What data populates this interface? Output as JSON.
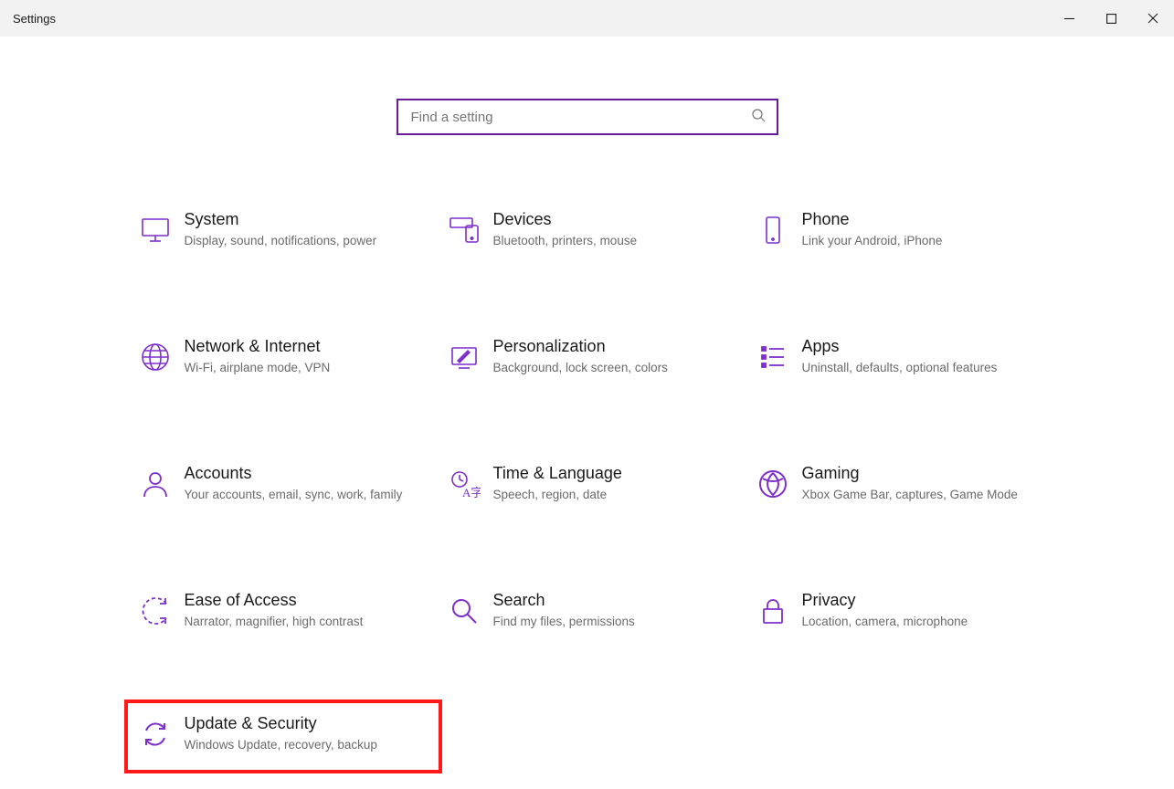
{
  "window": {
    "title": "Settings"
  },
  "search": {
    "placeholder": "Find a setting"
  },
  "tiles": [
    {
      "id": "system",
      "title": "System",
      "desc": "Display, sound, notifications, power"
    },
    {
      "id": "devices",
      "title": "Devices",
      "desc": "Bluetooth, printers, mouse"
    },
    {
      "id": "phone",
      "title": "Phone",
      "desc": "Link your Android, iPhone"
    },
    {
      "id": "network",
      "title": "Network & Internet",
      "desc": "Wi-Fi, airplane mode, VPN"
    },
    {
      "id": "personalization",
      "title": "Personalization",
      "desc": "Background, lock screen, colors"
    },
    {
      "id": "apps",
      "title": "Apps",
      "desc": "Uninstall, defaults, optional features"
    },
    {
      "id": "accounts",
      "title": "Accounts",
      "desc": "Your accounts, email, sync, work, family"
    },
    {
      "id": "time",
      "title": "Time & Language",
      "desc": "Speech, region, date"
    },
    {
      "id": "gaming",
      "title": "Gaming",
      "desc": "Xbox Game Bar, captures, Game Mode"
    },
    {
      "id": "ease",
      "title": "Ease of Access",
      "desc": "Narrator, magnifier, high contrast"
    },
    {
      "id": "searchcat",
      "title": "Search",
      "desc": "Find my files, permissions"
    },
    {
      "id": "privacy",
      "title": "Privacy",
      "desc": "Location, camera, microphone"
    },
    {
      "id": "update",
      "title": "Update & Security",
      "desc": "Windows Update, recovery, backup"
    }
  ],
  "highlightedTile": "update",
  "colors": {
    "accent": "#7e2fcc",
    "searchBorder": "#6a1b9a",
    "highlight": "#ff1a1a"
  }
}
